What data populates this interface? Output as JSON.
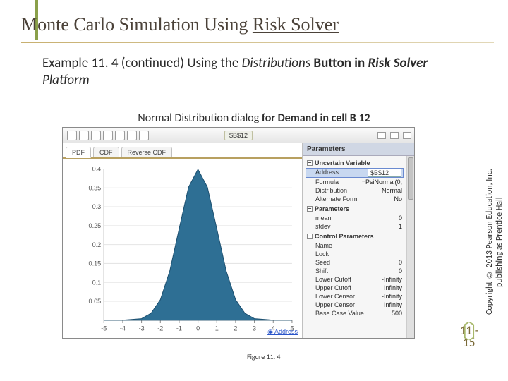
{
  "slide": {
    "title_plain": "Monte Carlo Simulation Using ",
    "title_ul": "Risk Solver",
    "example_line1_a": "Example 11. 4 (continued) Using the ",
    "example_line1_b": "Distributions",
    "example_line1_c": " Button in ",
    "example_line1_d": "Risk Solver",
    "example_line2": "Platform",
    "dialog_desc_a": "Normal Distribution dialog",
    "dialog_desc_b": " for ",
    "dialog_desc_c": "Demand",
    "dialog_desc_d": " in cell B 12"
  },
  "screenshot": {
    "toolbar_label": "$B$12",
    "tabs": {
      "pdf": "PDF",
      "cdf": "CDF",
      "rev": "Reverse CDF"
    },
    "address_link": "Address",
    "panel_title": "Parameters",
    "groups": {
      "uv": "Uncertain Variable",
      "params": "Parameters",
      "ctrl": "Control Parameters"
    },
    "uv": {
      "address_k": "Address",
      "address_v": "$B$12",
      "formula_k": "Formula",
      "formula_v": "=PsiNormal(0,",
      "dist_k": "Distribution",
      "dist_v": "Normal",
      "alt_k": "Alternate Form",
      "alt_v": "No"
    },
    "p": {
      "mean_k": "mean",
      "mean_v": "0",
      "stdev_k": "stdev",
      "stdev_v": "1"
    },
    "ctrl": {
      "name_k": "Name",
      "name_v": "",
      "lock_k": "Lock",
      "lock_v": "",
      "seed_k": "Seed",
      "seed_v": "0",
      "shift_k": "Shift",
      "shift_v": "0",
      "lcut_k": "Lower Cutoff",
      "lcut_v": "-Infinity",
      "ucut_k": "Upper Cutoff",
      "ucut_v": "Infinity",
      "lcen_k": "Lower Censor",
      "lcen_v": "-Infinity",
      "ucen_k": "Upper Censor",
      "ucen_v": "Infinity",
      "base_k": "Base Case Value",
      "base_v": "500"
    }
  },
  "chart_data": {
    "type": "area",
    "title": "",
    "xlabel": "",
    "ylabel": "",
    "xlim": [
      -5,
      5
    ],
    "ylim": [
      0,
      0.4
    ],
    "yticks": [
      0.05,
      0.1,
      0.15,
      0.2,
      0.25,
      0.3,
      0.35,
      0.4
    ],
    "xticks": [
      -5,
      -4,
      -3,
      -2,
      -1,
      0,
      1,
      2,
      3,
      4,
      5
    ],
    "x": [
      -5,
      -4,
      -3,
      -2.5,
      -2,
      -1.5,
      -1,
      -0.5,
      0,
      0.5,
      1,
      1.5,
      2,
      2.5,
      3,
      4,
      5
    ],
    "values": [
      0,
      0.0001,
      0.004,
      0.018,
      0.054,
      0.13,
      0.242,
      0.352,
      0.399,
      0.352,
      0.242,
      0.13,
      0.054,
      0.018,
      0.004,
      0.0001,
      0
    ]
  },
  "footer": {
    "copyright": "Copyright © 2013 Pearson Education, Inc. publishing as Prentice Hall",
    "page_a": "11 -",
    "page_b": "15",
    "figure": "Figure 11. 4"
  }
}
